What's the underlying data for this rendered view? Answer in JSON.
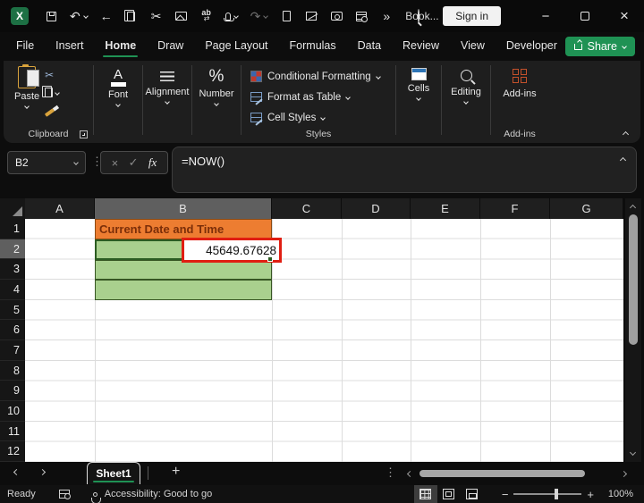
{
  "colors": {
    "accent": "#1f9254",
    "orange": "#ED7D31",
    "orange-text": "#7b2e09",
    "green-fill": "#A9D08E",
    "green-border": "#375623",
    "annotation": "#e01e12",
    "header-highlight": "#5f5f5f",
    "addins-orange": "#c4512b"
  },
  "titlebar": {
    "doc_title": "Book...",
    "sign_in": "Sign in",
    "overflow": "»"
  },
  "ribbon": {
    "tabs": [
      "File",
      "Insert",
      "Home",
      "Draw",
      "Page Layout",
      "Formulas",
      "Data",
      "Review",
      "View",
      "Developer",
      "Help"
    ],
    "active_tab": "Home",
    "share": "Share",
    "paste": "Paste",
    "clipboard_group": "Clipboard",
    "font_group": "Font",
    "alignment_group": "Alignment",
    "number_group": "Number",
    "conditional_formatting": "Conditional Formatting",
    "format_as_table": "Format as Table",
    "cell_styles": "Cell Styles",
    "styles_group": "Styles",
    "cells": "Cells",
    "editing": "Editing",
    "addins": "Add-ins",
    "addins_group": "Add-ins"
  },
  "formula_bar": {
    "name_box": "B2",
    "fx": "fx",
    "formula": "=NOW()"
  },
  "grid": {
    "columns": [
      "A",
      "B",
      "C",
      "D",
      "E",
      "F",
      "G"
    ],
    "rows": [
      "1",
      "2",
      "3",
      "4",
      "5",
      "6",
      "7",
      "8",
      "9",
      "10",
      "11",
      "12"
    ],
    "selected_cell": "B2",
    "b1_text": "Current Date and Time",
    "b2_value": "45649.67628"
  },
  "sheet_bar": {
    "sheet1": "Sheet1",
    "add_sheet": "+"
  },
  "status_bar": {
    "ready": "Ready",
    "accessibility": "Accessibility: Good to go",
    "zoom_level": "100%"
  },
  "glyphs": {
    "excel_logo": "X",
    "cut": "✂",
    "undo": "↶",
    "redo": "↷",
    "back": "←",
    "find_replace_ab": "ab",
    "find_replace_arrows": "⇄",
    "minimize": "−",
    "close": "×",
    "dots": "⋮",
    "cancel": "×",
    "enter": "✓",
    "font_letter": "A",
    "percent": "%",
    "check": "✓"
  }
}
